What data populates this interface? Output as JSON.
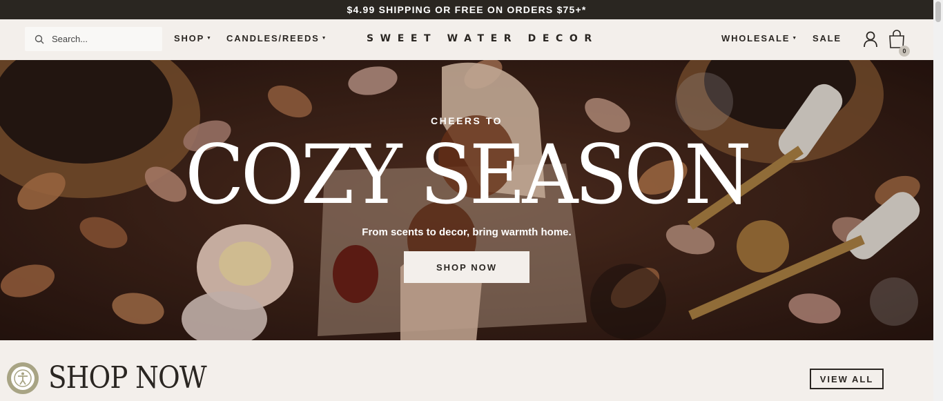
{
  "announcement": "$4.99 SHIPPING OR FREE ON ORDERS $75+*",
  "search": {
    "placeholder": "Search..."
  },
  "nav_left": [
    {
      "label": "SHOP",
      "caret": "▼"
    },
    {
      "label": "CANDLES/REEDS",
      "caret": "▼"
    }
  ],
  "logo": "SWEET WATER DECOR",
  "nav_right": [
    {
      "label": "WHOLESALE",
      "caret": "▼"
    },
    {
      "label": "SALE"
    }
  ],
  "cart": {
    "count": "0"
  },
  "hero": {
    "eyebrow": "CHEERS TO",
    "title": "COZY SEASON",
    "subtitle": "From scents to decor, bring warmth home.",
    "button": "SHOP NOW"
  },
  "section": {
    "title": "SHOP NOW",
    "view_all": "VIEW ALL"
  },
  "icons": {
    "search": "search-icon",
    "account": "account-icon",
    "cart": "cart-icon",
    "accessibility": "accessibility-icon"
  },
  "colors": {
    "announcement_bg": "#2a2621",
    "page_bg": "#f3efeb",
    "text": "#2a2622",
    "hero_bg": "#3b2217"
  }
}
